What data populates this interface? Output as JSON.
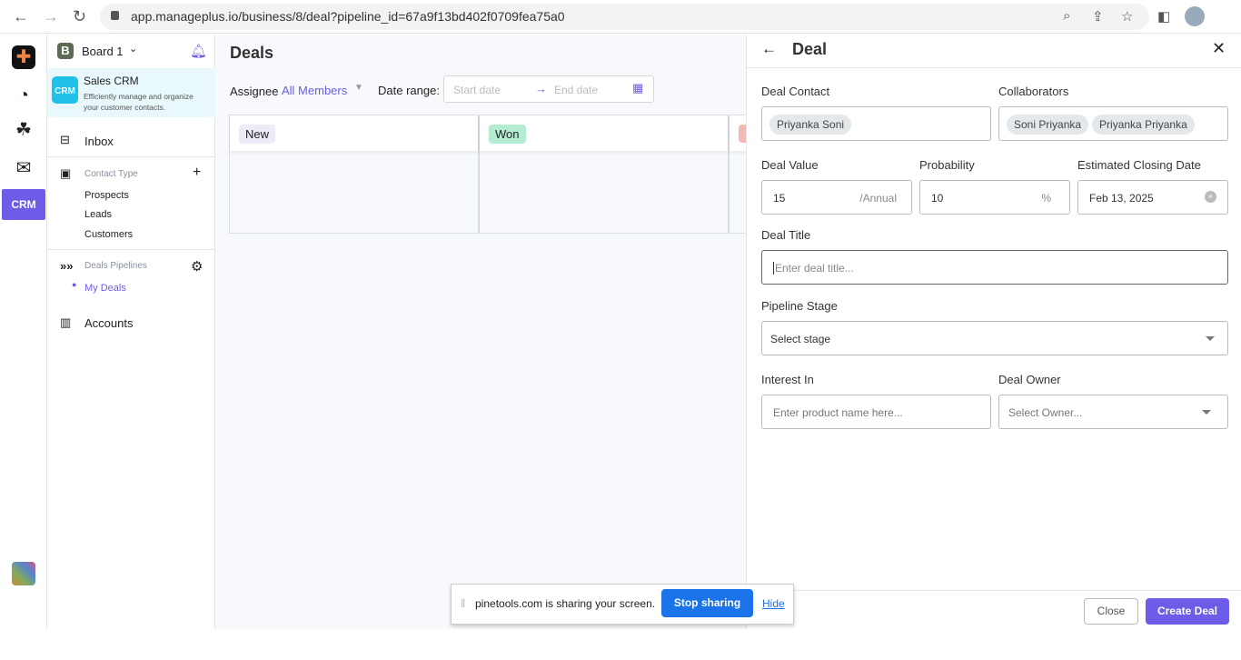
{
  "browser": {
    "url": "app.manageplus.io/business/8/deal?pipeline_id=67a9f13bd402f0709fea75a0"
  },
  "sidebar": {
    "board": "Board 1",
    "board_initial": "B",
    "app_name": "Sales CRM",
    "app_desc_1": "Efficiently manage and organize",
    "app_desc_2": "your customer contacts.",
    "app_logo": "CRM",
    "inbox": "Inbox",
    "contact_type": "Contact Type",
    "contact_items": [
      "Prospects",
      "Leads",
      "Customers"
    ],
    "deals_pipelines": "Deals Pipelines",
    "my_deals": "My Deals",
    "accounts": "Accounts"
  },
  "rail": {
    "crm": "CRM"
  },
  "main": {
    "title": "Deals",
    "assignee_label": "Assignee",
    "assignee_value": "All Members",
    "date_range_label": "Date range:",
    "start_placeholder": "Start date",
    "end_placeholder": "End date",
    "columns": [
      {
        "label": "New",
        "color": "#ecebf7"
      },
      {
        "label": "Won",
        "color": "#b3ecd0"
      },
      {
        "label": "",
        "color": "#f3b9b5"
      }
    ]
  },
  "panel": {
    "title": "Deal",
    "deal_contact_label": "Deal Contact",
    "deal_contact": [
      "Priyanka Soni"
    ],
    "collaborators_label": "Collaborators",
    "collaborators": [
      "Soni Priyanka",
      "Priyanka Priyanka"
    ],
    "deal_value_label": "Deal Value",
    "deal_value": "15",
    "deal_value_suffix": "/Annual",
    "probability_label": "Probability",
    "probability": "10",
    "probability_suffix": "%",
    "closing_label": "Estimated Closing Date",
    "closing_date": "Feb 13, 2025",
    "title_label": "Deal Title",
    "title_placeholder": "Enter deal title...",
    "stage_label": "Pipeline Stage",
    "stage_value": "Select stage",
    "interest_label": "Interest In",
    "interest_placeholder": "Enter product name here...",
    "owner_label": "Deal Owner",
    "owner_placeholder": "Select Owner...",
    "close": "Close",
    "create": "Create Deal",
    "accent": "#6c5ce7"
  },
  "share": {
    "text": "pinetools.com is sharing your screen.",
    "stop": "Stop sharing",
    "hide": "Hide"
  }
}
